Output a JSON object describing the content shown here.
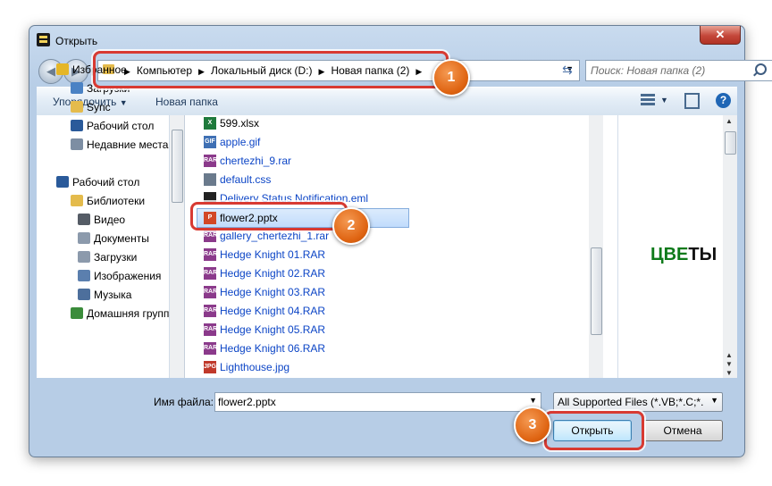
{
  "window": {
    "title": "Открыть",
    "close_glyph": "✕"
  },
  "address": {
    "crumbs": [
      "Компьютер",
      "Локальный диск (D:)",
      "Новая папка (2)"
    ],
    "search_placeholder": "Поиск: Новая папка (2)"
  },
  "toolbar": {
    "organize_label": "Упорядочить",
    "new_folder_label": "Новая папка",
    "help_glyph": "?"
  },
  "nav": {
    "items": [
      {
        "label": "Избранное",
        "icon": "star-icon",
        "color": "#e5b627"
      },
      {
        "label": "Загрузки",
        "icon": "downloads-folder-icon",
        "color": "#4a82c4"
      },
      {
        "label": "Sync",
        "icon": "folder-icon",
        "color": "#e4bb4c"
      },
      {
        "label": "Рабочий стол",
        "icon": "desktop-icon",
        "color": "#2a5a9a"
      },
      {
        "label": "Недавние места",
        "icon": "recent-places-icon",
        "color": "#7d8ea3"
      },
      {
        "label": "Рабочий стол",
        "icon": "desktop-icon",
        "color": "#2a5a9a"
      },
      {
        "label": "Библиотеки",
        "icon": "libraries-icon",
        "color": "#e4bb4c"
      },
      {
        "label": "Видео",
        "icon": "video-library-icon",
        "color": "#555c66"
      },
      {
        "label": "Документы",
        "icon": "documents-library-icon",
        "color": "#8c9aac"
      },
      {
        "label": "Загрузки",
        "icon": "downloads-library-icon",
        "color": "#8c9aac"
      },
      {
        "label": "Изображения",
        "icon": "pictures-library-icon",
        "color": "#5b7fae"
      },
      {
        "label": "Музыка",
        "icon": "music-library-icon",
        "color": "#4d6f9c"
      },
      {
        "label": "Домашняя группа",
        "icon": "homegroup-icon",
        "color": "#3b8c3b"
      }
    ]
  },
  "files": [
    {
      "name": "599.xlsx",
      "icon": "excel-file-icon",
      "color": "#1f7a3c",
      "glyph": "X",
      "link": false
    },
    {
      "name": "apple.gif",
      "icon": "gif-file-icon",
      "color": "#3f70b4",
      "glyph": "GIF",
      "link": true
    },
    {
      "name": "chertezhi_9.rar",
      "icon": "rar-archive-icon",
      "color": "#8b3a8b",
      "glyph": "RAR",
      "link": true
    },
    {
      "name": "default.css",
      "icon": "css-file-icon",
      "color": "#6a7a8c",
      "glyph": "",
      "link": true
    },
    {
      "name": "Delivery Status Notification.eml",
      "icon": "email-file-icon",
      "color": "#222222",
      "glyph": "",
      "link": true
    },
    {
      "name": "flower2.pptx",
      "icon": "powerpoint-file-icon",
      "color": "#d24726",
      "glyph": "P",
      "link": false
    },
    {
      "name": "gallery_chertezhi_1.rar",
      "icon": "rar-archive-icon",
      "color": "#8b3a8b",
      "glyph": "RAR",
      "link": true
    },
    {
      "name": "Hedge Knight 01.RAR",
      "icon": "rar-archive-icon",
      "color": "#8b3a8b",
      "glyph": "RAR",
      "link": true
    },
    {
      "name": "Hedge Knight 02.RAR",
      "icon": "rar-archive-icon",
      "color": "#8b3a8b",
      "glyph": "RAR",
      "link": true
    },
    {
      "name": "Hedge Knight 03.RAR",
      "icon": "rar-archive-icon",
      "color": "#8b3a8b",
      "glyph": "RAR",
      "link": true
    },
    {
      "name": "Hedge Knight 04.RAR",
      "icon": "rar-archive-icon",
      "color": "#8b3a8b",
      "glyph": "RAR",
      "link": true
    },
    {
      "name": "Hedge Knight 05.RAR",
      "icon": "rar-archive-icon",
      "color": "#8b3a8b",
      "glyph": "RAR",
      "link": true
    },
    {
      "name": "Hedge Knight 06.RAR",
      "icon": "rar-archive-icon",
      "color": "#8b3a8b",
      "glyph": "RAR",
      "link": true
    },
    {
      "name": "Lighthouse.jpg",
      "icon": "jpg-file-icon",
      "color": "#c0392b",
      "glyph": "JPG",
      "link": true
    }
  ],
  "selected_file": "flower2.pptx",
  "preview": {
    "word_part1": "ЦВЕ",
    "word_part2": "ТЫ"
  },
  "bottom": {
    "filename_label": "Имя файла:",
    "filename_value": "flower2.pptx",
    "filter_value": "All Supported Files (*.VB;*.C;*.C",
    "open_label": "Открыть",
    "cancel_label": "Отмена"
  },
  "annotations": {
    "badge1": "1",
    "badge2": "2",
    "badge3": "3",
    "highlight_color": "#d83a32",
    "badge_color": "#df6412"
  }
}
